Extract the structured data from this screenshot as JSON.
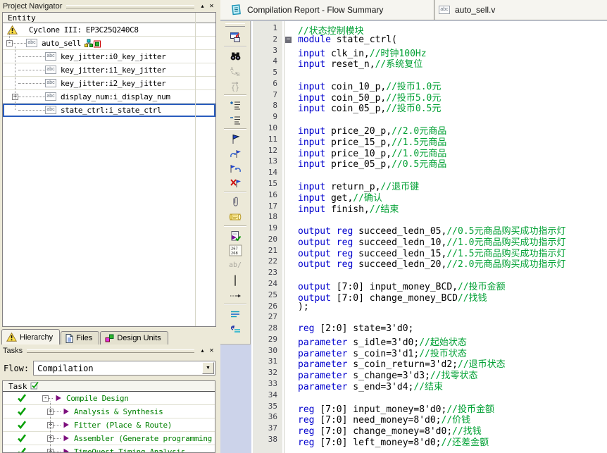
{
  "colors": {
    "panel_bg": "#ece9d8",
    "selection_border": "#2a5dbe",
    "keyword_blue": "#0000cd",
    "comment_green": "#00A033",
    "task_green": "#008000",
    "check_green": "#0aa00a",
    "play_purple": "#7d0f7d",
    "gutter_bg": "#e8e8e2",
    "toolbar_fill": "#ccd3ea"
  },
  "project_navigator": {
    "title": "Project Navigator",
    "column_header": "Entity",
    "tree": [
      {
        "label": "Cyclone III: EP3C25Q240C8",
        "icon": "warning-icon",
        "indent": 0
      },
      {
        "label": "auto_sell",
        "icon": "abc-icon",
        "indent": 1,
        "expander": "-",
        "badge": "hierarchy-badge-icon"
      },
      {
        "label": "key_jitter:i0_key_jitter",
        "icon": "abc-icon",
        "indent": 2
      },
      {
        "label": "key_jitter:i1_key_jitter",
        "icon": "abc-icon",
        "indent": 2
      },
      {
        "label": "key_jitter:i2_key_jitter",
        "icon": "abc-icon",
        "indent": 2
      },
      {
        "label": "display_num:i_display_num",
        "icon": "abc-icon",
        "indent": 2,
        "expander": "+"
      },
      {
        "label": "state_ctrl:i_state_ctrl",
        "icon": "abc-icon",
        "indent": 2,
        "selected": true
      }
    ],
    "tabs": [
      {
        "label": "Hierarchy",
        "icon": "warning-icon",
        "active": true
      },
      {
        "label": "Files",
        "icon": "file-icon",
        "active": false
      },
      {
        "label": "Design Units",
        "icon": "design-units-icon",
        "active": false
      }
    ]
  },
  "tasks_panel": {
    "title": "Tasks",
    "flow_label": "Flow:",
    "flow_value": "Compilation",
    "task_header": "Task",
    "rows": [
      {
        "label": "Compile Design",
        "expander": "-",
        "indent": 0,
        "status": "done"
      },
      {
        "label": "Analysis & Synthesis",
        "expander": "+",
        "indent": 1,
        "status": "done"
      },
      {
        "label": "Fitter (Place & Route)",
        "expander": "+",
        "indent": 1,
        "status": "done"
      },
      {
        "label": "Assembler (Generate programming",
        "expander": "+",
        "indent": 1,
        "status": "done"
      },
      {
        "label": "TimeQuest Timing Analysis",
        "expander": "+",
        "indent": 1,
        "status": "done"
      }
    ]
  },
  "editor": {
    "tabs": [
      {
        "label": "Compilation Report - Flow Summary",
        "icon": "report-icon"
      },
      {
        "label": "auto_sell.v",
        "icon": "abc-icon"
      }
    ],
    "abc_icon_text": "abc",
    "toolbar": [
      {
        "name": "window-arrow-icon"
      },
      {
        "name": "find-icon",
        "sep_before": true
      },
      {
        "name": "replace-icon",
        "disabled": true
      },
      {
        "name": "match-brace-icon",
        "disabled": true
      },
      {
        "name": "increase-indent-icon",
        "sep_before": true
      },
      {
        "name": "decrease-indent-icon"
      },
      {
        "name": "toggle-bookmark-icon",
        "sep_before": true
      },
      {
        "name": "next-bookmark-icon"
      },
      {
        "name": "previous-bookmark-icon"
      },
      {
        "name": "clear-bookmarks-icon"
      },
      {
        "name": "attach-file-icon",
        "sep_before": true
      },
      {
        "name": "insert-template-icon"
      },
      {
        "name": "analyze-file-icon",
        "sep_before": true
      },
      {
        "name": "goto-line-icon",
        "text": "267 268"
      },
      {
        "name": "comment-text-icon",
        "text": "ab/",
        "disabled": true
      },
      {
        "name": "text-cursor-icon",
        "text": "|"
      },
      {
        "name": "dotted-arrow-icon"
      },
      {
        "name": "wrap-lines-icon",
        "sep_before": true
      },
      {
        "name": "resync-icon"
      }
    ],
    "code_lines": [
      {
        "n": 1,
        "s": [
          [
            "c",
            "//状态控制模块"
          ]
        ]
      },
      {
        "n": 2,
        "fold": true,
        "s": [
          [
            "k",
            "module"
          ],
          [
            "t",
            " state_ctrl("
          ]
        ]
      },
      {
        "n": 3,
        "s": [
          [
            "k",
            "input"
          ],
          [
            "t",
            " clk_in,"
          ],
          [
            "c",
            "//时钟100Hz"
          ]
        ]
      },
      {
        "n": 4,
        "s": [
          [
            "k",
            "input"
          ],
          [
            "t",
            " reset_n,"
          ],
          [
            "c",
            "//系统复位"
          ]
        ]
      },
      {
        "n": 5,
        "s": []
      },
      {
        "n": 6,
        "s": [
          [
            "k",
            "input"
          ],
          [
            "t",
            " coin_10_p,"
          ],
          [
            "c",
            "//投币1.0元"
          ]
        ]
      },
      {
        "n": 7,
        "s": [
          [
            "k",
            "input"
          ],
          [
            "t",
            " coin_50_p,"
          ],
          [
            "c",
            "//投币5.0元"
          ]
        ]
      },
      {
        "n": 8,
        "s": [
          [
            "k",
            "input"
          ],
          [
            "t",
            " coin_05_p,"
          ],
          [
            "c",
            "//投币0.5元"
          ]
        ]
      },
      {
        "n": 9,
        "s": []
      },
      {
        "n": 10,
        "s": [
          [
            "k",
            "input"
          ],
          [
            "t",
            " price_20_p,"
          ],
          [
            "c",
            "//2.0元商品"
          ]
        ]
      },
      {
        "n": 11,
        "s": [
          [
            "k",
            "input"
          ],
          [
            "t",
            " price_15_p,"
          ],
          [
            "c",
            "//1.5元商品"
          ]
        ]
      },
      {
        "n": 12,
        "s": [
          [
            "k",
            "input"
          ],
          [
            "t",
            " price_10_p,"
          ],
          [
            "c",
            "//1.0元商品"
          ]
        ]
      },
      {
        "n": 13,
        "s": [
          [
            "k",
            "input"
          ],
          [
            "t",
            " price_05_p,"
          ],
          [
            "c",
            "//0.5元商品"
          ]
        ]
      },
      {
        "n": 14,
        "s": []
      },
      {
        "n": 15,
        "s": [
          [
            "k",
            "input"
          ],
          [
            "t",
            " return_p,"
          ],
          [
            "c",
            "//退币键"
          ]
        ]
      },
      {
        "n": 16,
        "s": [
          [
            "k",
            "input"
          ],
          [
            "t",
            " get,"
          ],
          [
            "c",
            "//确认"
          ]
        ]
      },
      {
        "n": 17,
        "s": [
          [
            "k",
            "input"
          ],
          [
            "t",
            " finish,"
          ],
          [
            "c",
            "//结束"
          ]
        ]
      },
      {
        "n": 18,
        "s": []
      },
      {
        "n": 19,
        "s": [
          [
            "k",
            "output"
          ],
          [
            "t",
            " "
          ],
          [
            "k",
            "reg"
          ],
          [
            "t",
            " succeed_ledn_05,"
          ],
          [
            "c",
            "//0.5元商品购买成功指示灯"
          ]
        ]
      },
      {
        "n": 20,
        "s": [
          [
            "k",
            "output"
          ],
          [
            "t",
            " "
          ],
          [
            "k",
            "reg"
          ],
          [
            "t",
            " succeed_ledn_10,"
          ],
          [
            "c",
            "//1.0元商品购买成功指示灯"
          ]
        ]
      },
      {
        "n": 21,
        "s": [
          [
            "k",
            "output"
          ],
          [
            "t",
            " "
          ],
          [
            "k",
            "reg"
          ],
          [
            "t",
            " succeed_ledn_15,"
          ],
          [
            "c",
            "//1.5元商品购买成功指示灯"
          ]
        ]
      },
      {
        "n": 22,
        "s": [
          [
            "k",
            "output"
          ],
          [
            "t",
            " "
          ],
          [
            "k",
            "reg"
          ],
          [
            "t",
            " succeed_ledn_20,"
          ],
          [
            "c",
            "//2.0元商品购买成功指示灯"
          ]
        ]
      },
      {
        "n": 23,
        "s": []
      },
      {
        "n": 24,
        "s": [
          [
            "k",
            "output"
          ],
          [
            "t",
            " [7:0] input_money_BCD,"
          ],
          [
            "c",
            "//投币金额"
          ]
        ]
      },
      {
        "n": 25,
        "s": [
          [
            "k",
            "output"
          ],
          [
            "t",
            " [7:0] change_money_BCD"
          ],
          [
            "c",
            "//找钱"
          ]
        ]
      },
      {
        "n": 26,
        "s": [
          [
            "t",
            ");"
          ]
        ]
      },
      {
        "n": 27,
        "s": []
      },
      {
        "n": 28,
        "s": [
          [
            "k",
            "reg"
          ],
          [
            "t",
            " [2:0] state=3'd0;"
          ]
        ]
      },
      {
        "n": 29,
        "s": [
          [
            "k",
            "parameter"
          ],
          [
            "t",
            " s_idle=3'd0;"
          ],
          [
            "c",
            "//起始状态"
          ]
        ]
      },
      {
        "n": 30,
        "s": [
          [
            "k",
            "parameter"
          ],
          [
            "t",
            " s_coin=3'd1;"
          ],
          [
            "c",
            "//投币状态"
          ]
        ]
      },
      {
        "n": 31,
        "s": [
          [
            "k",
            "parameter"
          ],
          [
            "t",
            " s_coin_return=3'd2;"
          ],
          [
            "c",
            "//退币状态"
          ]
        ]
      },
      {
        "n": 32,
        "s": [
          [
            "k",
            "parameter"
          ],
          [
            "t",
            " s_change=3'd3;"
          ],
          [
            "c",
            "//找零状态"
          ]
        ]
      },
      {
        "n": 33,
        "s": [
          [
            "k",
            "parameter"
          ],
          [
            "t",
            " s_end=3'd4;"
          ],
          [
            "c",
            "//结束"
          ]
        ]
      },
      {
        "n": 34,
        "s": []
      },
      {
        "n": 35,
        "s": [
          [
            "k",
            "reg"
          ],
          [
            "t",
            " [7:0] input_money=8'd0;"
          ],
          [
            "c",
            "//投币金额"
          ]
        ]
      },
      {
        "n": 36,
        "s": [
          [
            "k",
            "reg"
          ],
          [
            "t",
            " [7:0] need_money=8'd0;"
          ],
          [
            "c",
            "//价钱"
          ]
        ]
      },
      {
        "n": 37,
        "s": [
          [
            "k",
            "reg"
          ],
          [
            "t",
            " [7:0] change_money=8'd0;"
          ],
          [
            "c",
            "//找钱"
          ]
        ]
      },
      {
        "n": 38,
        "s": [
          [
            "k",
            "reg"
          ],
          [
            "t",
            " [7:0] left_money=8'd0;"
          ],
          [
            "c",
            "//还差金额"
          ]
        ]
      }
    ]
  }
}
